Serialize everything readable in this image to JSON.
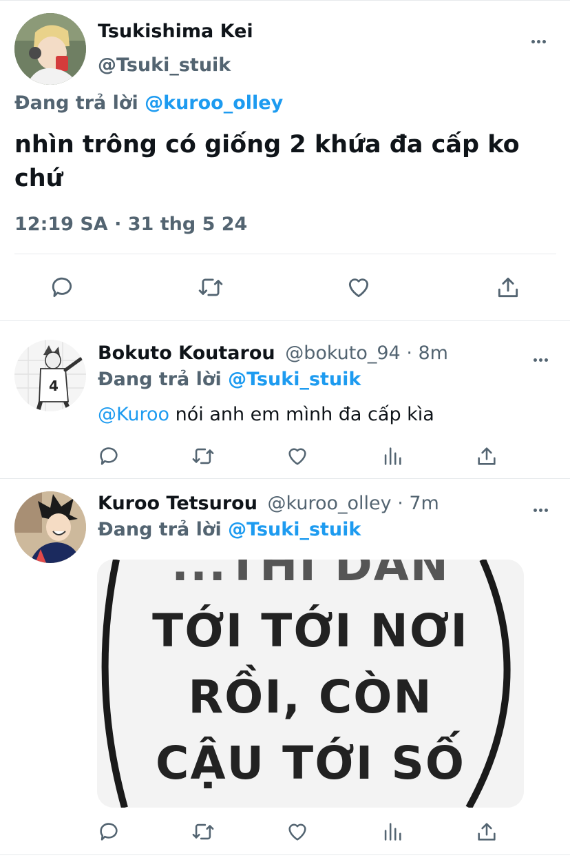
{
  "main_tweet": {
    "display_name": "Tsukishima Kei",
    "handle": "@Tsuki_stuik",
    "replying_prefix": "Đang trả lời",
    "replying_to": "@kuroo_olley",
    "text": "nhìn trông có giống 2 khứa đa cấp ko chứ",
    "timestamp": "12:19 SA · 31 thg 5 24",
    "actions": [
      "reply-icon",
      "retweet-icon",
      "like-icon",
      "share-icon"
    ]
  },
  "replies": [
    {
      "display_name": "Bokuto Koutarou",
      "handle": "@bokuto_94",
      "time": "· 8m",
      "replying_prefix": "Đang trả lời",
      "replying_to": "@Tsuki_stuik",
      "mention": "@Kuroo",
      "text": " nói anh em mình đa cấp kìa",
      "actions": [
        "reply-icon",
        "retweet-icon",
        "like-icon",
        "views-icon",
        "share-icon"
      ]
    },
    {
      "display_name": "Kuroo Tetsurou",
      "handle": "@kuroo_olley",
      "time": "· 7m",
      "replying_prefix": "Đang trả lời",
      "replying_to": "@Tsuki_stuik",
      "image_text": [
        "...THÌ DẪN",
        "TỚI TỚI NƠI",
        "RỒI, CÒN",
        "CẬU TỚI SỐ"
      ],
      "actions": [
        "reply-icon",
        "retweet-icon",
        "like-icon",
        "views-icon",
        "share-icon"
      ]
    }
  ],
  "colors": {
    "accent": "#1d9bf0",
    "secondary_text": "#536471",
    "divider": "#e6e9ec"
  }
}
